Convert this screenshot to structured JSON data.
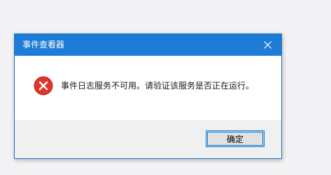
{
  "dialog": {
    "title": "事件查看器",
    "close_icon": "close-icon",
    "message": "事件日志服务不可用。请验证该服务是否正在运行。",
    "status_icon": "error-icon",
    "ok_label": "确定"
  },
  "colors": {
    "titlebar": "#1d7cd6",
    "error": "#e0352b",
    "button_border": "#0078d7",
    "desktop": "#f3f2f4"
  }
}
